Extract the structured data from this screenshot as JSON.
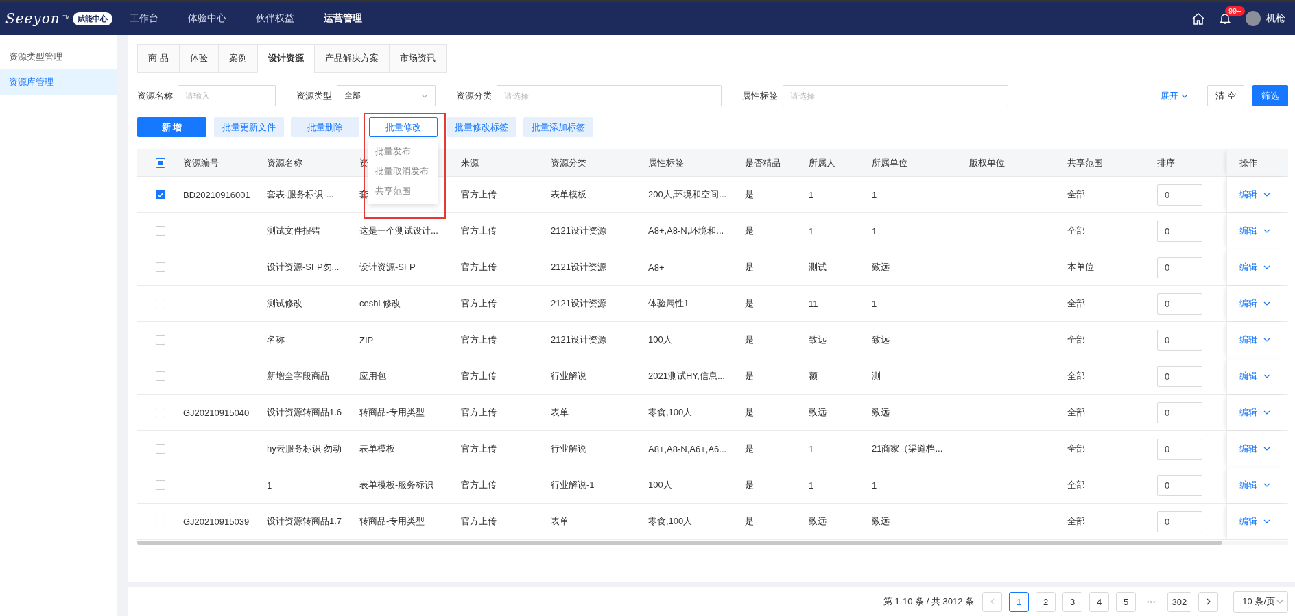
{
  "topbar": {
    "logo": {
      "text": "Seeyon",
      "tm": "TM",
      "badge": "赋能中心"
    },
    "nav": [
      {
        "label": "工作台",
        "selected": false
      },
      {
        "label": "体验中心",
        "selected": false
      },
      {
        "label": "伙伴权益",
        "selected": false
      },
      {
        "label": "运营管理",
        "selected": true
      }
    ],
    "notifications": {
      "badge": "99+"
    },
    "user": {
      "name": "机枪"
    }
  },
  "sidebar": {
    "items": [
      {
        "label": "资源类型管理",
        "selected": false
      },
      {
        "label": "资源库管理",
        "selected": true
      }
    ]
  },
  "tabs": [
    {
      "label": "商 品",
      "selected": false
    },
    {
      "label": "体验",
      "selected": false
    },
    {
      "label": "案例",
      "selected": false
    },
    {
      "label": "设计资源",
      "selected": true
    },
    {
      "label": "产品解决方案",
      "selected": false
    },
    {
      "label": "市场资讯",
      "selected": false
    }
  ],
  "filters": [
    {
      "label": "资源名称",
      "kind": "input",
      "placeholder": "请输入"
    },
    {
      "label": "资源类型",
      "kind": "select",
      "value": "全部"
    },
    {
      "label": "资源分类",
      "kind": "input",
      "placeholder": "请选择"
    },
    {
      "label": "属性标签",
      "kind": "input",
      "placeholder": "请选择"
    }
  ],
  "filter_actions": {
    "expand": "展开",
    "clear": "清 空",
    "filter": "筛选"
  },
  "toolbar": [
    {
      "label": "新 增",
      "kind": "primary"
    },
    {
      "label": "批量更新文件",
      "kind": "light"
    },
    {
      "label": "批量删除",
      "kind": "light"
    },
    {
      "label": "批量修改",
      "kind": "outline"
    },
    {
      "label": "批量修改标签",
      "kind": "light"
    },
    {
      "label": "批量添加标签",
      "kind": "light"
    }
  ],
  "dropdown": {
    "items": [
      "批量发布",
      "批量取消发布",
      "共享范围"
    ]
  },
  "table": {
    "select_all": {
      "indeterminate": true
    },
    "columns": [
      "资源编号",
      "资源名称",
      "资",
      "来源",
      "资源分类",
      "属性标签",
      "是否精品",
      "所属人",
      "所属单位",
      "版权单位",
      "共享范围",
      "排序",
      "操作"
    ],
    "rows": [
      {
        "selected": true,
        "cells": [
          "BD20210916001",
          "套表-服务标识-...",
          "套",
          "官方上传",
          "表单模板",
          "200人,环境和空间...",
          "是",
          "1",
          "1",
          null,
          "全部"
        ],
        "sort": "0",
        "action": "编辑"
      },
      {
        "selected": false,
        "cells": [
          null,
          "测试文件报错",
          "这是一个测试设计...",
          "官方上传",
          "2121设计资源",
          "A8+,A8-N,环境和...",
          "是",
          "1",
          "1",
          null,
          "全部"
        ],
        "sort": "0",
        "action": "编辑"
      },
      {
        "selected": false,
        "cells": [
          null,
          "设计资源-SFP勿...",
          "设计资源-SFP",
          "官方上传",
          "2121设计资源",
          "A8+",
          "是",
          "测试",
          "致远",
          null,
          "本单位"
        ],
        "sort": "0",
        "action": "编辑"
      },
      {
        "selected": false,
        "cells": [
          null,
          "测试修改",
          "ceshi 修改",
          "官方上传",
          "2121设计资源",
          "体验属性1",
          "是",
          "11",
          "1",
          null,
          "全部"
        ],
        "sort": "0",
        "action": "编辑"
      },
      {
        "selected": false,
        "cells": [
          null,
          "名称",
          "ZIP",
          "官方上传",
          "2121设计资源",
          "100人",
          "是",
          "致远",
          "致远",
          null,
          "全部"
        ],
        "sort": "0",
        "action": "编辑"
      },
      {
        "selected": false,
        "cells": [
          null,
          "新增全字段商品",
          "应用包",
          "官方上传",
          "行业解说",
          "2021测试HY,信息...",
          "是",
          "额",
          "测",
          null,
          "全部"
        ],
        "sort": "0",
        "action": "编辑"
      },
      {
        "selected": false,
        "cells": [
          "GJ20210915040",
          "设计资源转商品1.6",
          "转商品-专用类型",
          "官方上传",
          "表单",
          "零食,100人",
          "是",
          "致远",
          "致远",
          null,
          "全部"
        ],
        "sort": "0",
        "action": "编辑"
      },
      {
        "selected": false,
        "cells": [
          null,
          "hy云服务标识-勿动",
          "表单模板",
          "官方上传",
          "行业解说",
          "A8+,A8-N,A6+,A6...",
          "是",
          "1",
          "21商家（渠道档...",
          null,
          "全部"
        ],
        "sort": "0",
        "action": "编辑"
      },
      {
        "selected": false,
        "cells": [
          null,
          "1",
          "表单模板-服务标识",
          "官方上传",
          "行业解说-1",
          "100人",
          "是",
          "1",
          "1",
          null,
          "全部"
        ],
        "sort": "0",
        "action": "编辑"
      },
      {
        "selected": false,
        "cells": [
          "GJ20210915039",
          "设计资源转商品1.7",
          "转商品-专用类型",
          "官方上传",
          "表单",
          "零食,100人",
          "是",
          "致远",
          "致远",
          null,
          "全部"
        ],
        "sort": "0",
        "action": "编辑"
      }
    ]
  },
  "pagination": {
    "summary": "第 1-10 条 / 共 3012 条",
    "pages": [
      {
        "label": "1",
        "selected": true
      },
      {
        "label": "2",
        "selected": false
      },
      {
        "label": "3",
        "selected": false
      },
      {
        "label": "4",
        "selected": false
      },
      {
        "label": "5",
        "selected": false
      }
    ],
    "ellipsis": "•••",
    "last": "302",
    "page_size": "10 条/页"
  }
}
